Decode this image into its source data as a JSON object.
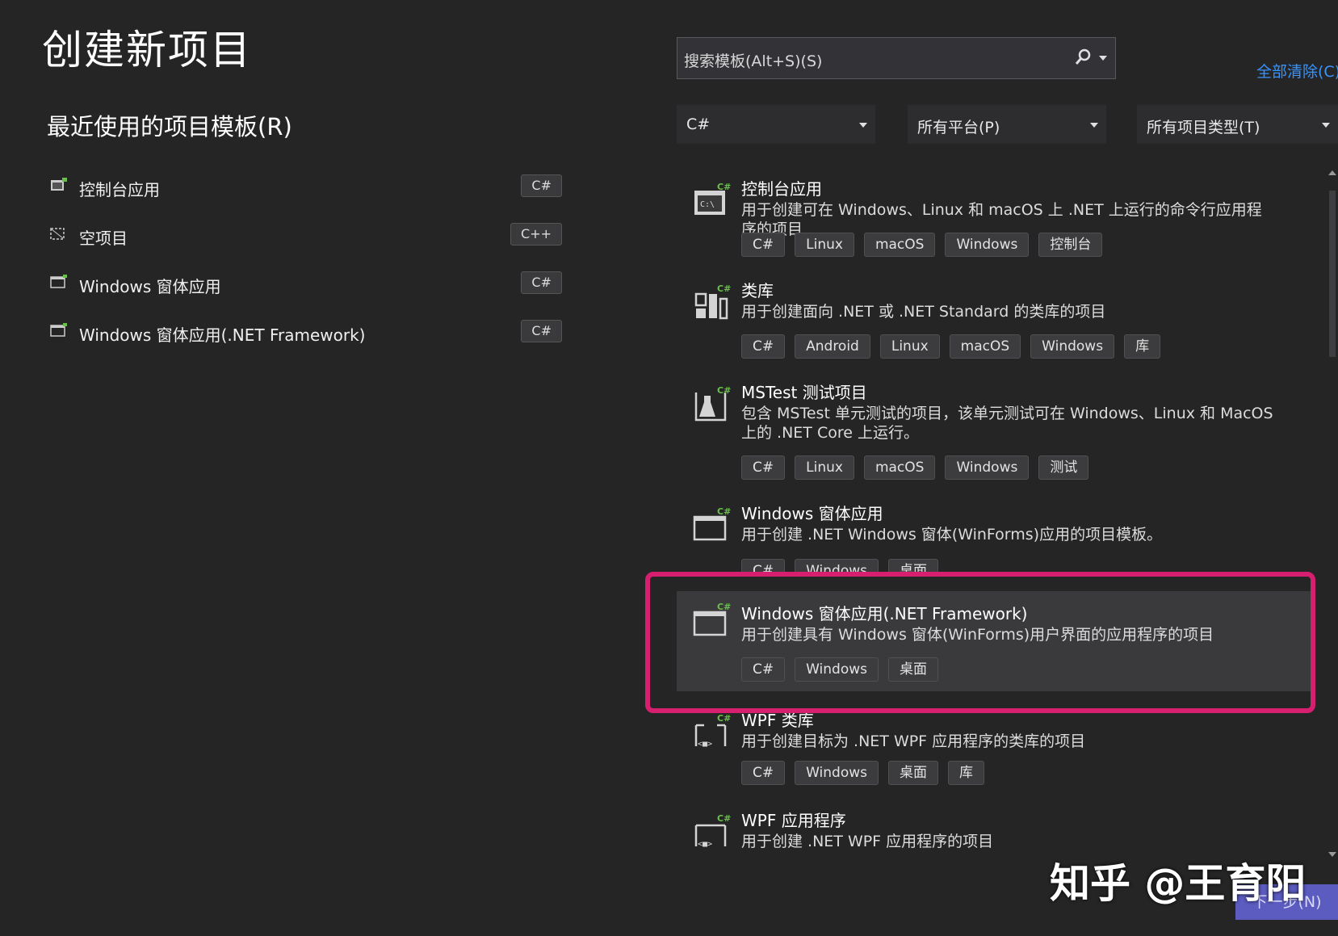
{
  "title": "创建新项目",
  "recent": {
    "heading": "最近使用的项目模板(R)",
    "items": [
      {
        "label": "控制台应用",
        "lang": "C#",
        "icon": "console-app-icon"
      },
      {
        "label": "空项目",
        "lang": "C++",
        "icon": "empty-project-icon"
      },
      {
        "label": "Windows 窗体应用",
        "lang": "C#",
        "icon": "window-form-icon"
      },
      {
        "label": "Windows 窗体应用(.NET Framework)",
        "lang": "C#",
        "icon": "window-form-icon"
      }
    ]
  },
  "search": {
    "placeholder": "搜索模板(Alt+S)(S)",
    "clear_all": "全部清除(C)"
  },
  "filters": {
    "language": "C#",
    "platform": "所有平台(P)",
    "project_type": "所有项目类型(T)"
  },
  "templates": [
    {
      "name": "控制台应用",
      "desc": "用于创建可在 Windows、Linux 和 macOS 上 .NET 上运行的命令行应用程序的项目",
      "tags": [
        "C#",
        "Linux",
        "macOS",
        "Windows",
        "控制台"
      ],
      "icon": "console-app-icon"
    },
    {
      "name": "类库",
      "desc": "用于创建面向 .NET 或 .NET Standard 的类库的项目",
      "tags": [
        "C#",
        "Android",
        "Linux",
        "macOS",
        "Windows",
        "库"
      ],
      "icon": "class-library-icon"
    },
    {
      "name": "MSTest 测试项目",
      "desc": "包含 MSTest 单元测试的项目，该单元测试可在 Windows、Linux 和 MacOS 上的 .NET Core 上运行。",
      "tags": [
        "C#",
        "Linux",
        "macOS",
        "Windows",
        "测试"
      ],
      "icon": "test-flask-icon"
    },
    {
      "name": "Windows 窗体应用",
      "desc": "用于创建 .NET Windows 窗体(WinForms)应用的项目模板。",
      "tags": [
        "C#",
        "Windows",
        "桌面"
      ],
      "icon": "window-form-icon"
    },
    {
      "name": "Windows 窗体应用(.NET Framework)",
      "desc": "用于创建具有 Windows 窗体(WinForms)用户界面的应用程序的项目",
      "tags": [
        "C#",
        "Windows",
        "桌面"
      ],
      "icon": "window-form-icon"
    },
    {
      "name": "WPF 类库",
      "desc": "用于创建目标为 .NET WPF 应用程序的类库的项目",
      "tags": [
        "C#",
        "Windows",
        "桌面",
        "库"
      ],
      "icon": "wpf-library-icon"
    },
    {
      "name": "WPF 应用程序",
      "desc": "用于创建 .NET WPF 应用程序的项目",
      "tags": [],
      "icon": "wpf-app-icon"
    }
  ],
  "watermark": "知乎 @王育阳",
  "next_label": "下一步(N)",
  "colors": {
    "background": "#252526",
    "highlight": "#d61f6e",
    "accent": "#3794ff",
    "next_button": "#5b5bc0"
  }
}
